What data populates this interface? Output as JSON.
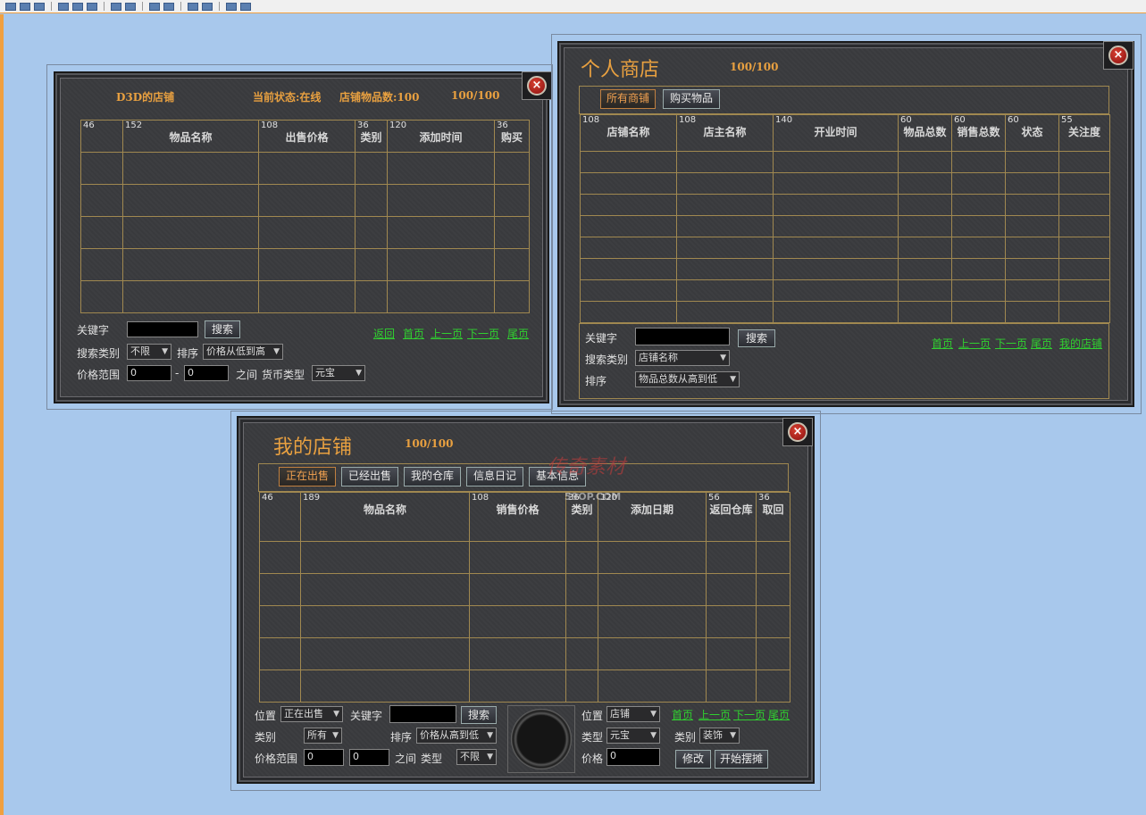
{
  "left_shop": {
    "title": "D3D的店铺",
    "status": "当前状态:在线",
    "item_count": "店铺物品数:100",
    "capacity": "100/100",
    "columns": [
      {
        "w": "46",
        "label": ""
      },
      {
        "w": "152",
        "label": "物品名称"
      },
      {
        "w": "108",
        "label": "出售价格"
      },
      {
        "w": "36",
        "label": "类别"
      },
      {
        "w": "120",
        "label": "添加时间"
      },
      {
        "w": "36",
        "label": "购买"
      }
    ],
    "keyword_label": "关键字",
    "keyword_value": "",
    "search_button": "搜索",
    "search_type_label": "搜索类别",
    "search_type_value": "不限",
    "sort_label": "排序",
    "sort_value": "价格从低到高",
    "price_range_label": "价格范围",
    "price_min": "0",
    "dash": "-",
    "price_max": "0",
    "between": "之间",
    "currency_label": "货币类型",
    "currency_value": "元宝",
    "links": [
      "返回",
      "首页",
      "上一页",
      "下一页",
      "尾页"
    ]
  },
  "personal_shop": {
    "title": "个人商店",
    "capacity": "100/100",
    "tabs": [
      "所有商铺",
      "购买物品"
    ],
    "columns": [
      {
        "w": "108",
        "label": "店铺名称"
      },
      {
        "w": "108",
        "label": "店主名称"
      },
      {
        "w": "140",
        "label": "开业时间"
      },
      {
        "w": "60",
        "label": "物品总数"
      },
      {
        "w": "60",
        "label": "销售总数"
      },
      {
        "w": "60",
        "label": "状态"
      },
      {
        "w": "55",
        "label": "关注度"
      }
    ],
    "keyword_label": "关键字",
    "keyword_value": "",
    "search_button": "搜索",
    "search_type_label": "搜索类别",
    "search_type_value": "店铺名称",
    "sort_label": "排序",
    "sort_value": "物品总数从高到低",
    "links": [
      "首页",
      "上一页",
      "下一页",
      "尾页",
      "我的店铺"
    ]
  },
  "my_shop": {
    "title": "我的店铺",
    "capacity": "100/100",
    "tabs": [
      "正在出售",
      "已经出售",
      "我的仓库",
      "信息日记",
      "基本信息"
    ],
    "watermark": "传奇素材",
    "watermark_url": "59OP.COM",
    "columns": [
      {
        "w": "46",
        "label": ""
      },
      {
        "w": "189",
        "label": "物品名称"
      },
      {
        "w": "108",
        "label": "销售价格"
      },
      {
        "w": "36",
        "label": "类别"
      },
      {
        "w": "120",
        "label": "添加日期"
      },
      {
        "w": "56",
        "label": "返回仓库"
      },
      {
        "w": "36",
        "label": "取回"
      }
    ],
    "position_label": "位置",
    "position_value": "正在出售",
    "keyword_label": "关键字",
    "keyword_value": "",
    "search_button": "搜索",
    "category_label": "类别",
    "category_value": "所有",
    "sort_label": "排序",
    "sort_value": "价格从高到低",
    "price_range_label": "价格范围",
    "price_min": "0",
    "price_max": "0",
    "between": "之间",
    "type_label": "类型",
    "type_value": "不限",
    "right_position_label": "位置",
    "right_position_value": "店铺",
    "right_type_label": "类型",
    "right_type_value": "元宝",
    "right_category_label": "类别",
    "right_category_value": "装饰",
    "right_price_label": "价格",
    "right_price_value": "0",
    "links": [
      "首页",
      "上一页",
      "下一页",
      "尾页"
    ],
    "modify_button": "修改",
    "start_button": "开始摆摊"
  }
}
